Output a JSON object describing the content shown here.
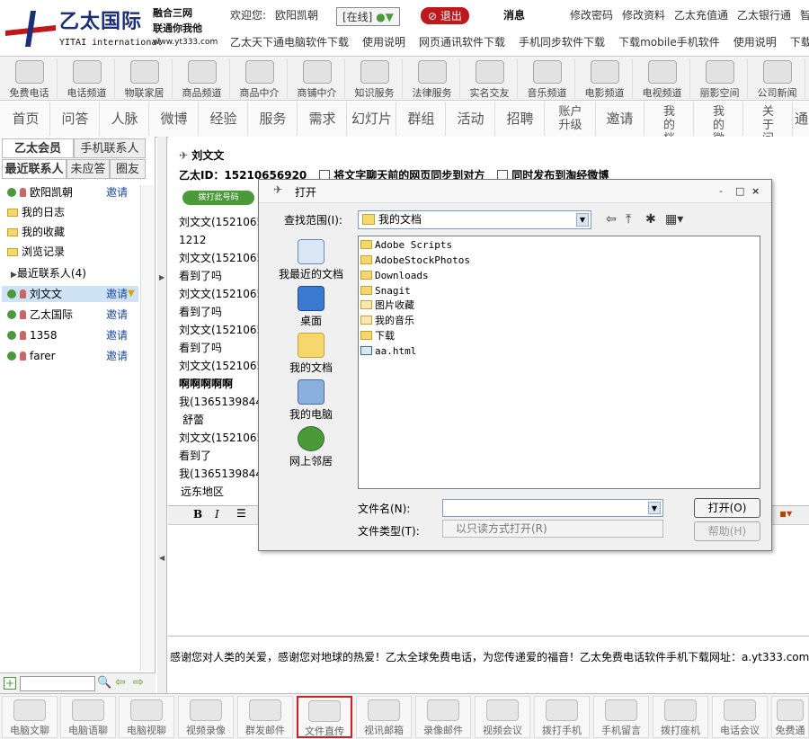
{
  "header": {
    "brand_cn": "乙太国际",
    "brand_en": "YITAI international",
    "slogan1": "融合三网",
    "slogan2": "联通你我他",
    "site": "www.yt333.com",
    "welcome": "欢迎您:",
    "user": "欧阳凯朝",
    "status": "[在线]",
    "exit": "退出",
    "message": "消息",
    "links_top": [
      "修改密码",
      "修改资料",
      "乙太充值通",
      "乙太银行通",
      "智"
    ],
    "links_bottom": [
      "乙太天下通电脑软件下载",
      "使用说明",
      "网页通讯软件下载",
      "手机同步软件下载",
      "下载mobile手机软件",
      "使用说明",
      "下载"
    ]
  },
  "toolbar1": [
    "免费电话",
    "电话频道",
    "物联家居",
    "商品频道",
    "商品中介",
    "商铺中介",
    "知识服务",
    "法律服务",
    "实名交友",
    "音乐频道",
    "电影频道",
    "电视频道",
    "丽影空间",
    "公司新闻"
  ],
  "nav2": [
    "首页",
    "问答",
    "人脉",
    "微博",
    "经验",
    "服务",
    "需求",
    "幻灯片",
    "群组",
    "活动",
    "招聘",
    "账户升级",
    "邀请",
    "我的档案",
    "我的微博",
    "关于问答",
    "通"
  ],
  "left": {
    "tabs": [
      "乙太会员",
      "手机联系人",
      "最近联系人",
      "未应答",
      "圈友"
    ],
    "items": [
      {
        "label": "欧阳凯朝",
        "invite": "邀请",
        "type": "contact"
      },
      {
        "label": "我的日志",
        "type": "folder"
      },
      {
        "label": "我的收藏",
        "type": "folder"
      },
      {
        "label": "浏览记录",
        "type": "folder"
      },
      {
        "label": "最近联系人(4)",
        "type": "group"
      },
      {
        "label": "刘文文",
        "invite": "邀请",
        "type": "contact"
      },
      {
        "label": "乙太国际",
        "invite": "邀请",
        "type": "contact"
      },
      {
        "label": "1358",
        "invite": "邀请",
        "type": "contact"
      },
      {
        "label": "farer",
        "invite": "邀请",
        "type": "contact"
      }
    ]
  },
  "chat": {
    "name": "刘文文",
    "id_line": "乙太ID：15210656920",
    "opt1": "将文字聊天前的网页同步到对方",
    "opt2": "同时发布到淘经微博",
    "dial": "拨打此号码",
    "messages": [
      "刘文文(15210656",
      "1212",
      "刘文文(15210656",
      "看到了吗",
      "刘文文(15210656",
      "看到了吗",
      "刘文文(15210656",
      "看到了吗",
      "刘文文(15210656",
      "啊啊啊啊啊",
      "我(13651398446)",
      "舒蕾",
      "刘文文(15210656",
      "看到了",
      "我(13651398446)",
      "远东地区"
    ],
    "footer": "感谢您对人类的关爱，感谢您对地球的热爱！乙太全球免费电话，为您传递爱的福音！乙太免费电话软件手机下载网址：a.yt333.com"
  },
  "toolbar3": [
    "电脑文聊",
    "电脑语聊",
    "电脑视聊",
    "视频录像",
    "群发邮件",
    "文件直传",
    "视讯邮箱",
    "录像邮件",
    "视频会议",
    "拨打手机",
    "手机留言",
    "拨打座机",
    "电话会议",
    "免费通"
  ],
  "toolbar3_selected": "文件直传",
  "dialog": {
    "title": "打开",
    "look_in_label": "查找范围(I):",
    "look_in_value": "我的文档",
    "places": [
      "我最近的文档",
      "桌面",
      "我的文档",
      "我的电脑",
      "网上邻居"
    ],
    "files": [
      "Adobe Scripts",
      "AdobeStockPhotos",
      "Downloads",
      "Snagit",
      "图片收藏",
      "我的音乐",
      "下载",
      "aa.html"
    ],
    "filename_label": "文件名(N):",
    "filename_value": "",
    "filetype_label": "文件类型(T):",
    "readonly_label": "以只读方式打开(R)",
    "open_button": "打开(O)",
    "help_button": "帮助(H)",
    "controls": [
      "-",
      "□",
      "×"
    ]
  },
  "colors": {
    "brand": "#1a2f7a",
    "exit": "#c0171c",
    "online": "#4a9a3a",
    "link": "#1a4aa0",
    "selected_border": "#d02020"
  }
}
